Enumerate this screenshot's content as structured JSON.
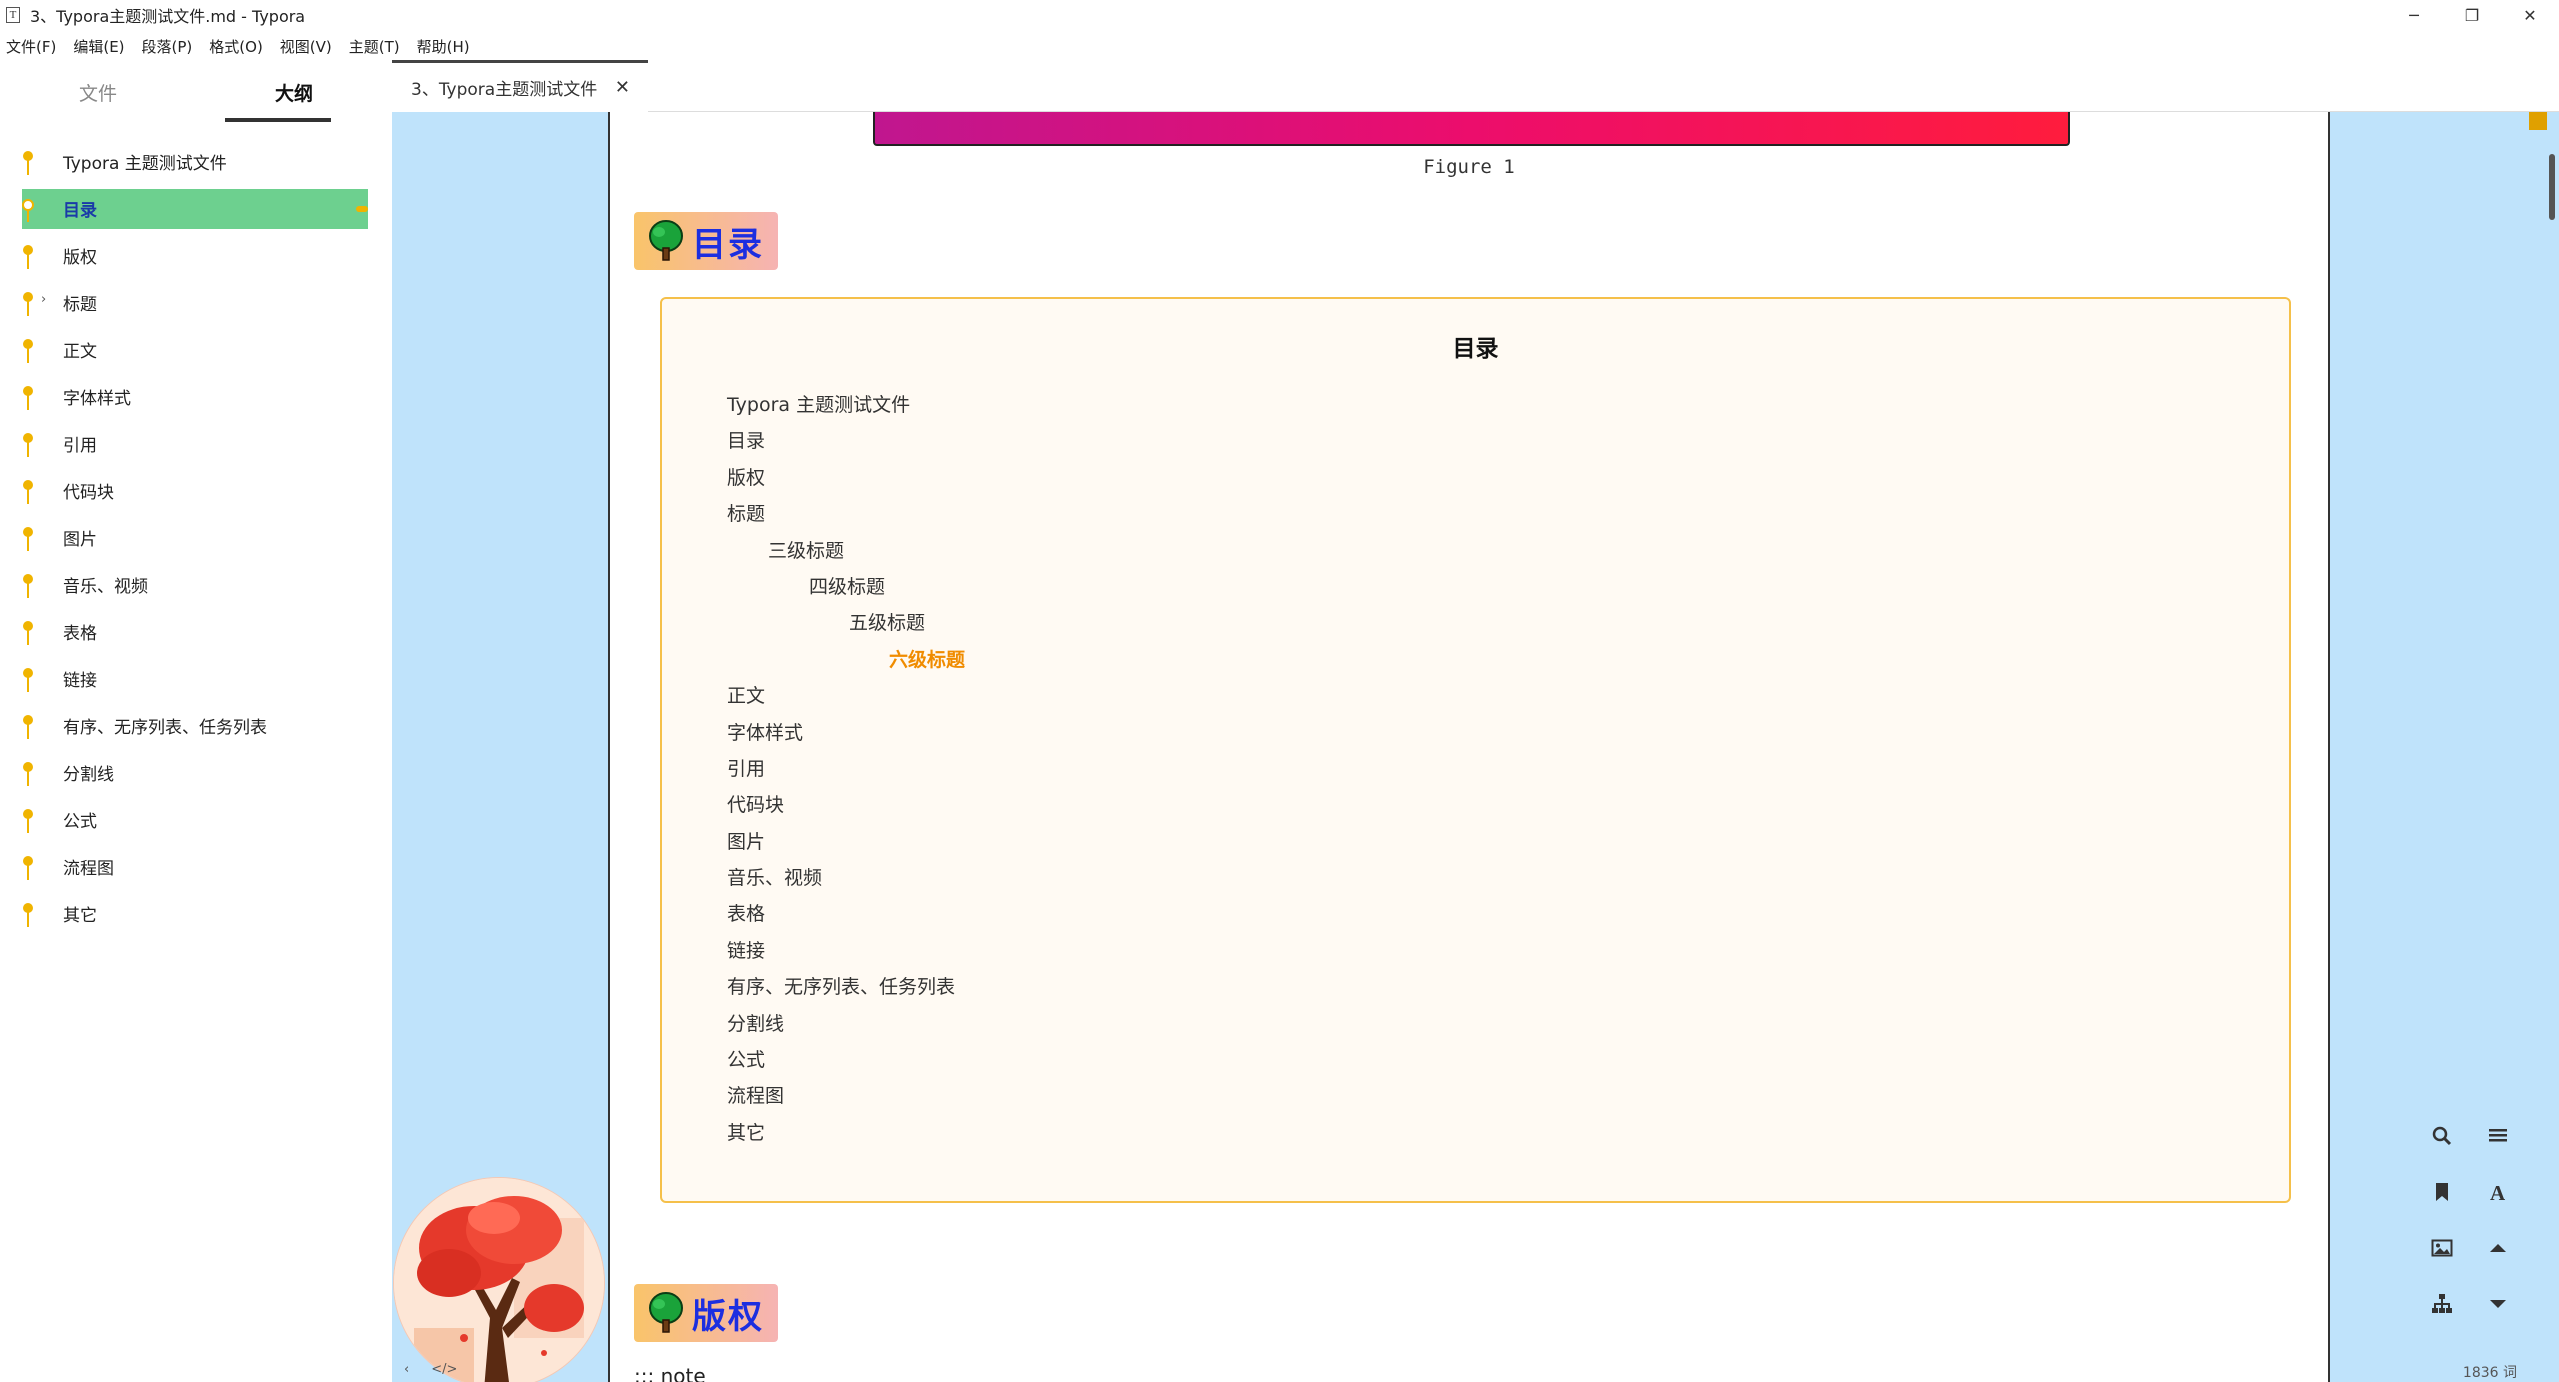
{
  "window": {
    "app_icon": "T",
    "title": "3、Typora主题测试文件.md - Typora",
    "minimize": "─",
    "restore": "❐",
    "close": "✕"
  },
  "menu": [
    "文件(F)",
    "编辑(E)",
    "段落(P)",
    "格式(O)",
    "视图(V)",
    "主题(T)",
    "帮助(H)"
  ],
  "sidebar": {
    "tabs": [
      "文件",
      "大纲"
    ],
    "active_tab": "大纲",
    "outline": [
      {
        "label": "Typora 主题测试文件"
      },
      {
        "label": "目录",
        "active": true
      },
      {
        "label": "版权"
      },
      {
        "label": "标题",
        "collapsed": true
      },
      {
        "label": "正文"
      },
      {
        "label": "字体样式"
      },
      {
        "label": "引用"
      },
      {
        "label": "代码块"
      },
      {
        "label": "图片"
      },
      {
        "label": "音乐、视频"
      },
      {
        "label": "表格"
      },
      {
        "label": "链接"
      },
      {
        "label": "有序、无序列表、任务列表"
      },
      {
        "label": "分割线"
      },
      {
        "label": "公式"
      },
      {
        "label": "流程图"
      },
      {
        "label": "其它"
      }
    ],
    "bottom_icons": [
      "‹",
      "</>"
    ]
  },
  "tab": {
    "label": "3、Typora主题测试文件",
    "close": "✕"
  },
  "doc": {
    "figure_caption": "Figure 1",
    "heading_toc": "目录",
    "heading_copyright": "版权",
    "toc_title": "目录",
    "toc": [
      {
        "label": "Typora 主题测试文件",
        "level": 1
      },
      {
        "label": "目录",
        "level": 2
      },
      {
        "label": "版权",
        "level": 2
      },
      {
        "label": "标题",
        "level": 2
      },
      {
        "label": "三级标题",
        "level": 3
      },
      {
        "label": "四级标题",
        "level": 4
      },
      {
        "label": "五级标题",
        "level": 5
      },
      {
        "label": "六级标题",
        "level": 6
      },
      {
        "label": "正文",
        "level": 2
      },
      {
        "label": "字体样式",
        "level": 2
      },
      {
        "label": "引用",
        "level": 2
      },
      {
        "label": "代码块",
        "level": 2
      },
      {
        "label": "图片",
        "level": 2
      },
      {
        "label": "音乐、视频",
        "level": 2
      },
      {
        "label": "表格",
        "level": 2
      },
      {
        "label": "链接",
        "level": 2
      },
      {
        "label": "有序、无序列表、任务列表",
        "level": 2
      },
      {
        "label": "分割线",
        "level": 2
      },
      {
        "label": "公式",
        "level": 2
      },
      {
        "label": "流程图",
        "level": 2
      },
      {
        "label": "其它",
        "level": 2
      }
    ],
    "note_text": "::: note"
  },
  "toolbar": {
    "buttons": [
      "search-icon",
      "list-icon",
      "bookmark-icon",
      "font-icon",
      "image-icon",
      "arrow-up-icon",
      "sitemap-icon",
      "arrow-down-icon"
    ]
  },
  "status": {
    "word_count": "1836 词"
  },
  "colors": {
    "accent": "#f0b400",
    "active_outline": "#6dd08f",
    "heading_text": "#1c2ee0",
    "canvas_bg": "#bfe3fb",
    "toc_border": "#f5c04a",
    "h6_color": "#f08c00"
  }
}
